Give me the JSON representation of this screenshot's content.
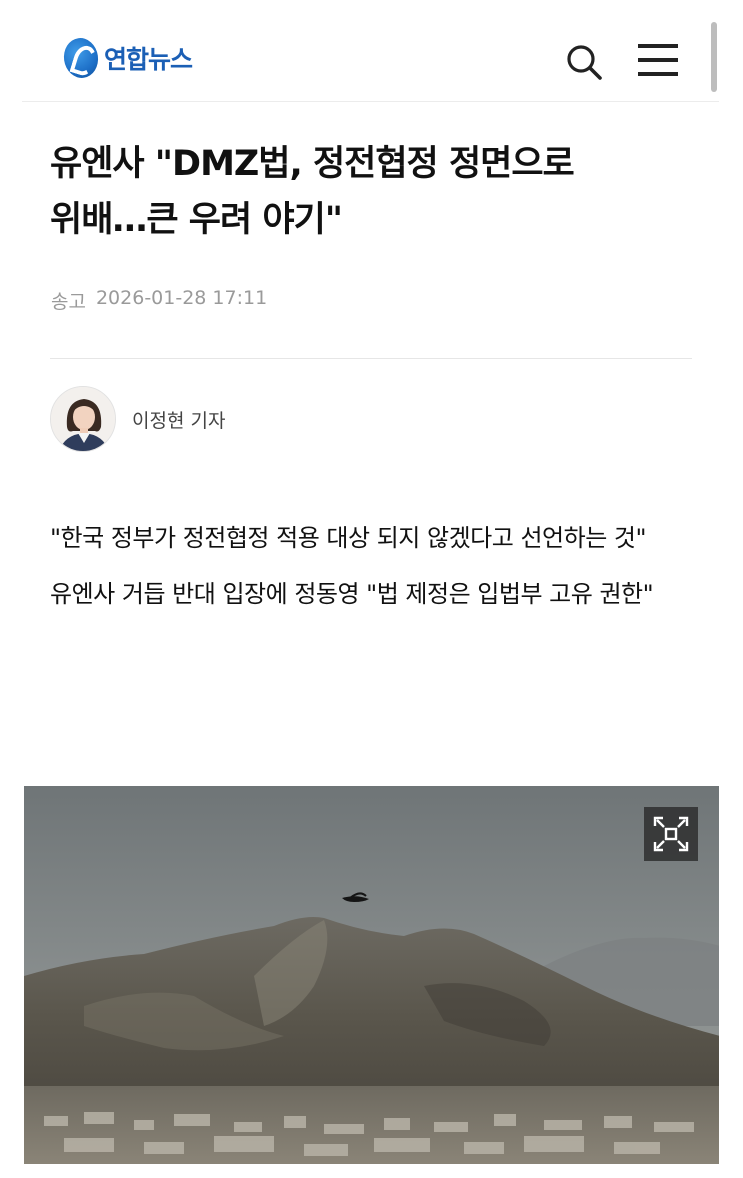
{
  "header": {
    "logo_text": "연합뉴스",
    "search_icon": "search-icon",
    "menu_icon": "hamburger-menu-icon"
  },
  "article": {
    "title_line1": "유엔사 \"DMZ법, 정전협정 정면으로",
    "title_line2": "위배…큰 우려 야기\"",
    "date_label": "송고",
    "date_value": "2026-01-28 17:11",
    "author": "이정현 기자",
    "summary": [
      "\"한국 정부가 정전협정 적용 대상 되지 않겠다고 선언하는 것\"",
      "유엔사 거듭 반대 입장에 정동영 \"법 제정은 입법부 고유 권한\""
    ],
    "photo_expand_icon": "expand-fullscreen-icon"
  },
  "colors": {
    "brand": "#1b5fb5",
    "text": "#111111",
    "muted": "#9a9a9a"
  }
}
